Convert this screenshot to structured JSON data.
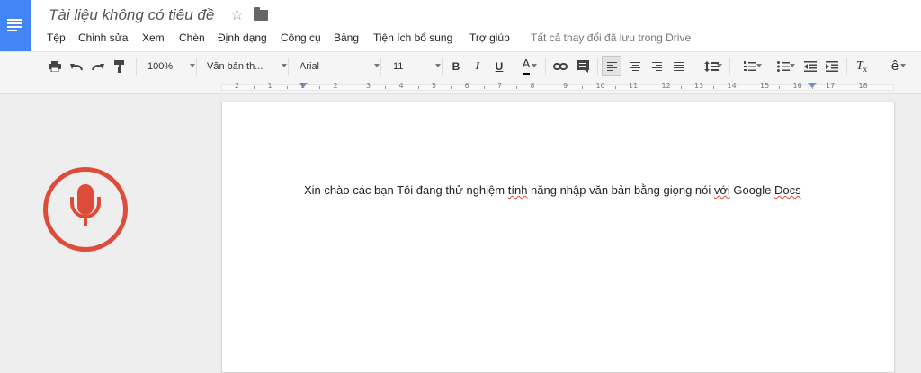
{
  "header": {
    "doc_title": "Tài liệu không có tiêu đề",
    "star_glyph": "☆",
    "menu": [
      "Tệp",
      "Chỉnh sửa",
      "Xem",
      "Chèn",
      "Định dạng",
      "Công cụ",
      "Bảng",
      "Tiện ích bổ sung",
      "Trợ giúp"
    ],
    "save_status": "Tất cả thay đổi đã lưu trong Drive"
  },
  "toolbar": {
    "zoom": "100%",
    "style": "Văn bản th...",
    "font": "Arial",
    "font_size": "11",
    "bold": "B",
    "italic": "I",
    "underline": "U",
    "text_color": "A",
    "clear_format": "T",
    "input_tools": "ê"
  },
  "ruler": {
    "labels": [
      "2",
      "1",
      "1",
      "2",
      "3",
      "4",
      "5",
      "6",
      "7",
      "8",
      "9",
      "10",
      "11",
      "12",
      "13",
      "14",
      "15",
      "16",
      "17",
      "18"
    ]
  },
  "document": {
    "text_part1": "Xin chào các bạn Tôi đang thử nghiệm ",
    "text_spell1": "tính",
    "text_part2": " năng nhập văn bản bằng giọng nói ",
    "text_spell2": "với",
    "text_part3": " Google ",
    "text_spell3": "Docs"
  },
  "colors": {
    "brand": "#4285f4",
    "mic": "#dd4b39",
    "spellcheck": "#e04a3c"
  },
  "icons": [
    "docs-logo-icon",
    "star-icon",
    "folder-icon",
    "print-icon",
    "undo-icon",
    "redo-icon",
    "paint-format-icon",
    "link-icon",
    "comment-icon",
    "line-spacing-icon",
    "numbered-list-icon",
    "bulleted-list-icon",
    "decrease-indent-icon",
    "increase-indent-icon",
    "clear-formatting-icon",
    "microphone-icon"
  ]
}
